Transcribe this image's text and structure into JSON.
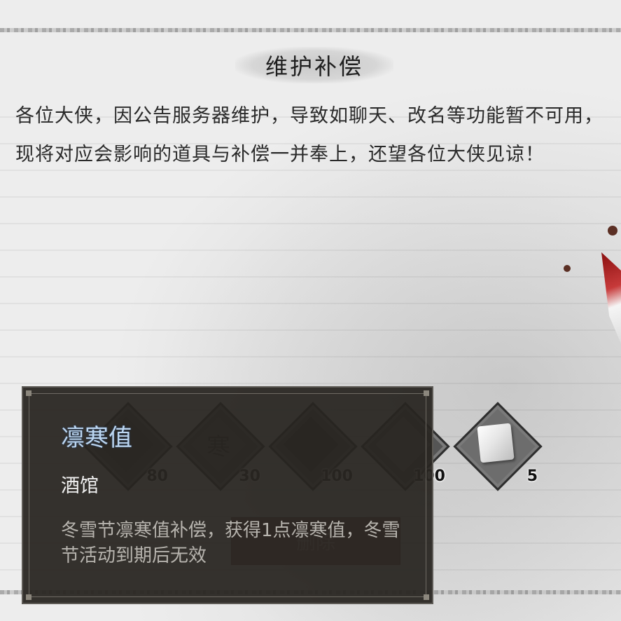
{
  "mail": {
    "title": "维护补偿",
    "body": "各位大侠，因公告服务器维护，导致如聊天、改名等功能暂不可用，现将对应会影响的道具与补偿一并奉上，还望各位大侠见谅！"
  },
  "rewards": [
    {
      "icon": "wine-jar-icon",
      "count": "80"
    },
    {
      "icon": "cold-token-icon",
      "glyph": "寒",
      "count": "30"
    },
    {
      "icon": "ration-icon",
      "count": "100"
    },
    {
      "icon": "herb-icon",
      "count": "100"
    },
    {
      "icon": "silk-cloth-icon",
      "count": "5"
    }
  ],
  "actions": {
    "delete_label": "删除"
  },
  "tooltip": {
    "name": "凛寒值",
    "category": "酒馆",
    "description": "冬雪节凛寒值补偿，获得1点凛寒值，冬雪节活动到期后无效"
  },
  "colors": {
    "tooltip_bg": "#282521",
    "item_name": "#bcd6f0",
    "delete_button": "#8a5550"
  }
}
